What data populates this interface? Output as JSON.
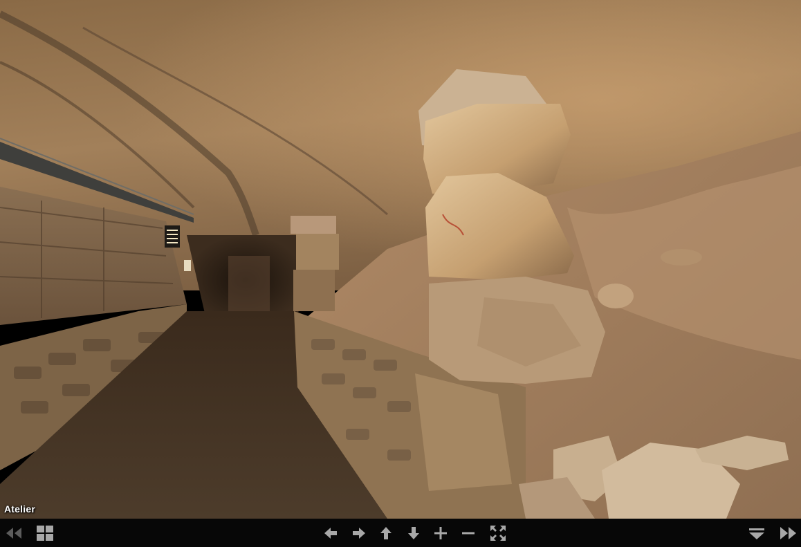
{
  "scene": {
    "title": "Atelier"
  },
  "controls": {
    "previous": "previous-scene-icon",
    "thumbnails": "thumbnails-grid-icon",
    "left": "arrow-left-icon",
    "right": "arrow-right-icon",
    "up": "arrow-up-icon",
    "down": "arrow-down-icon",
    "zoom_in": "plus-icon",
    "zoom_out": "minus-icon",
    "fullscreen": "fullscreen-icon",
    "hide_bar": "hide-controls-icon",
    "next": "next-scene-icon"
  },
  "colors": {
    "icon": "#9a9a9a",
    "bar": "#0c0c0c"
  }
}
